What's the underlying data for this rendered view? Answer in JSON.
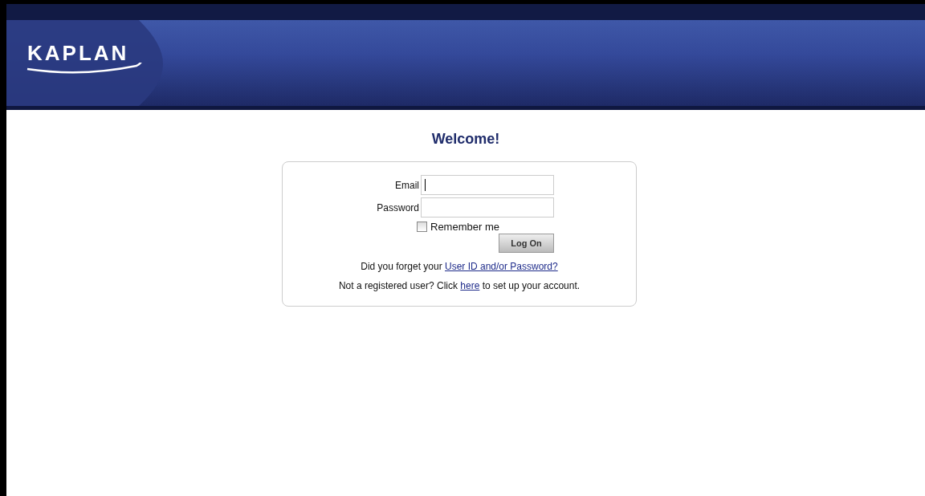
{
  "header": {
    "logo": "KAPLAN"
  },
  "login": {
    "heading": "Welcome!",
    "fields": [
      {
        "label": "Email",
        "focused": true
      },
      {
        "label": "Password",
        "focused": false
      }
    ],
    "remember": {
      "label": "Remember me",
      "checked": false
    },
    "button": "Log On",
    "forgot": {
      "before": "Did you forget your ",
      "link": "User ID and/or Password?"
    },
    "register": {
      "before": "Not a registered user? Click ",
      "link": "here",
      "after": " to set up your account."
    }
  }
}
